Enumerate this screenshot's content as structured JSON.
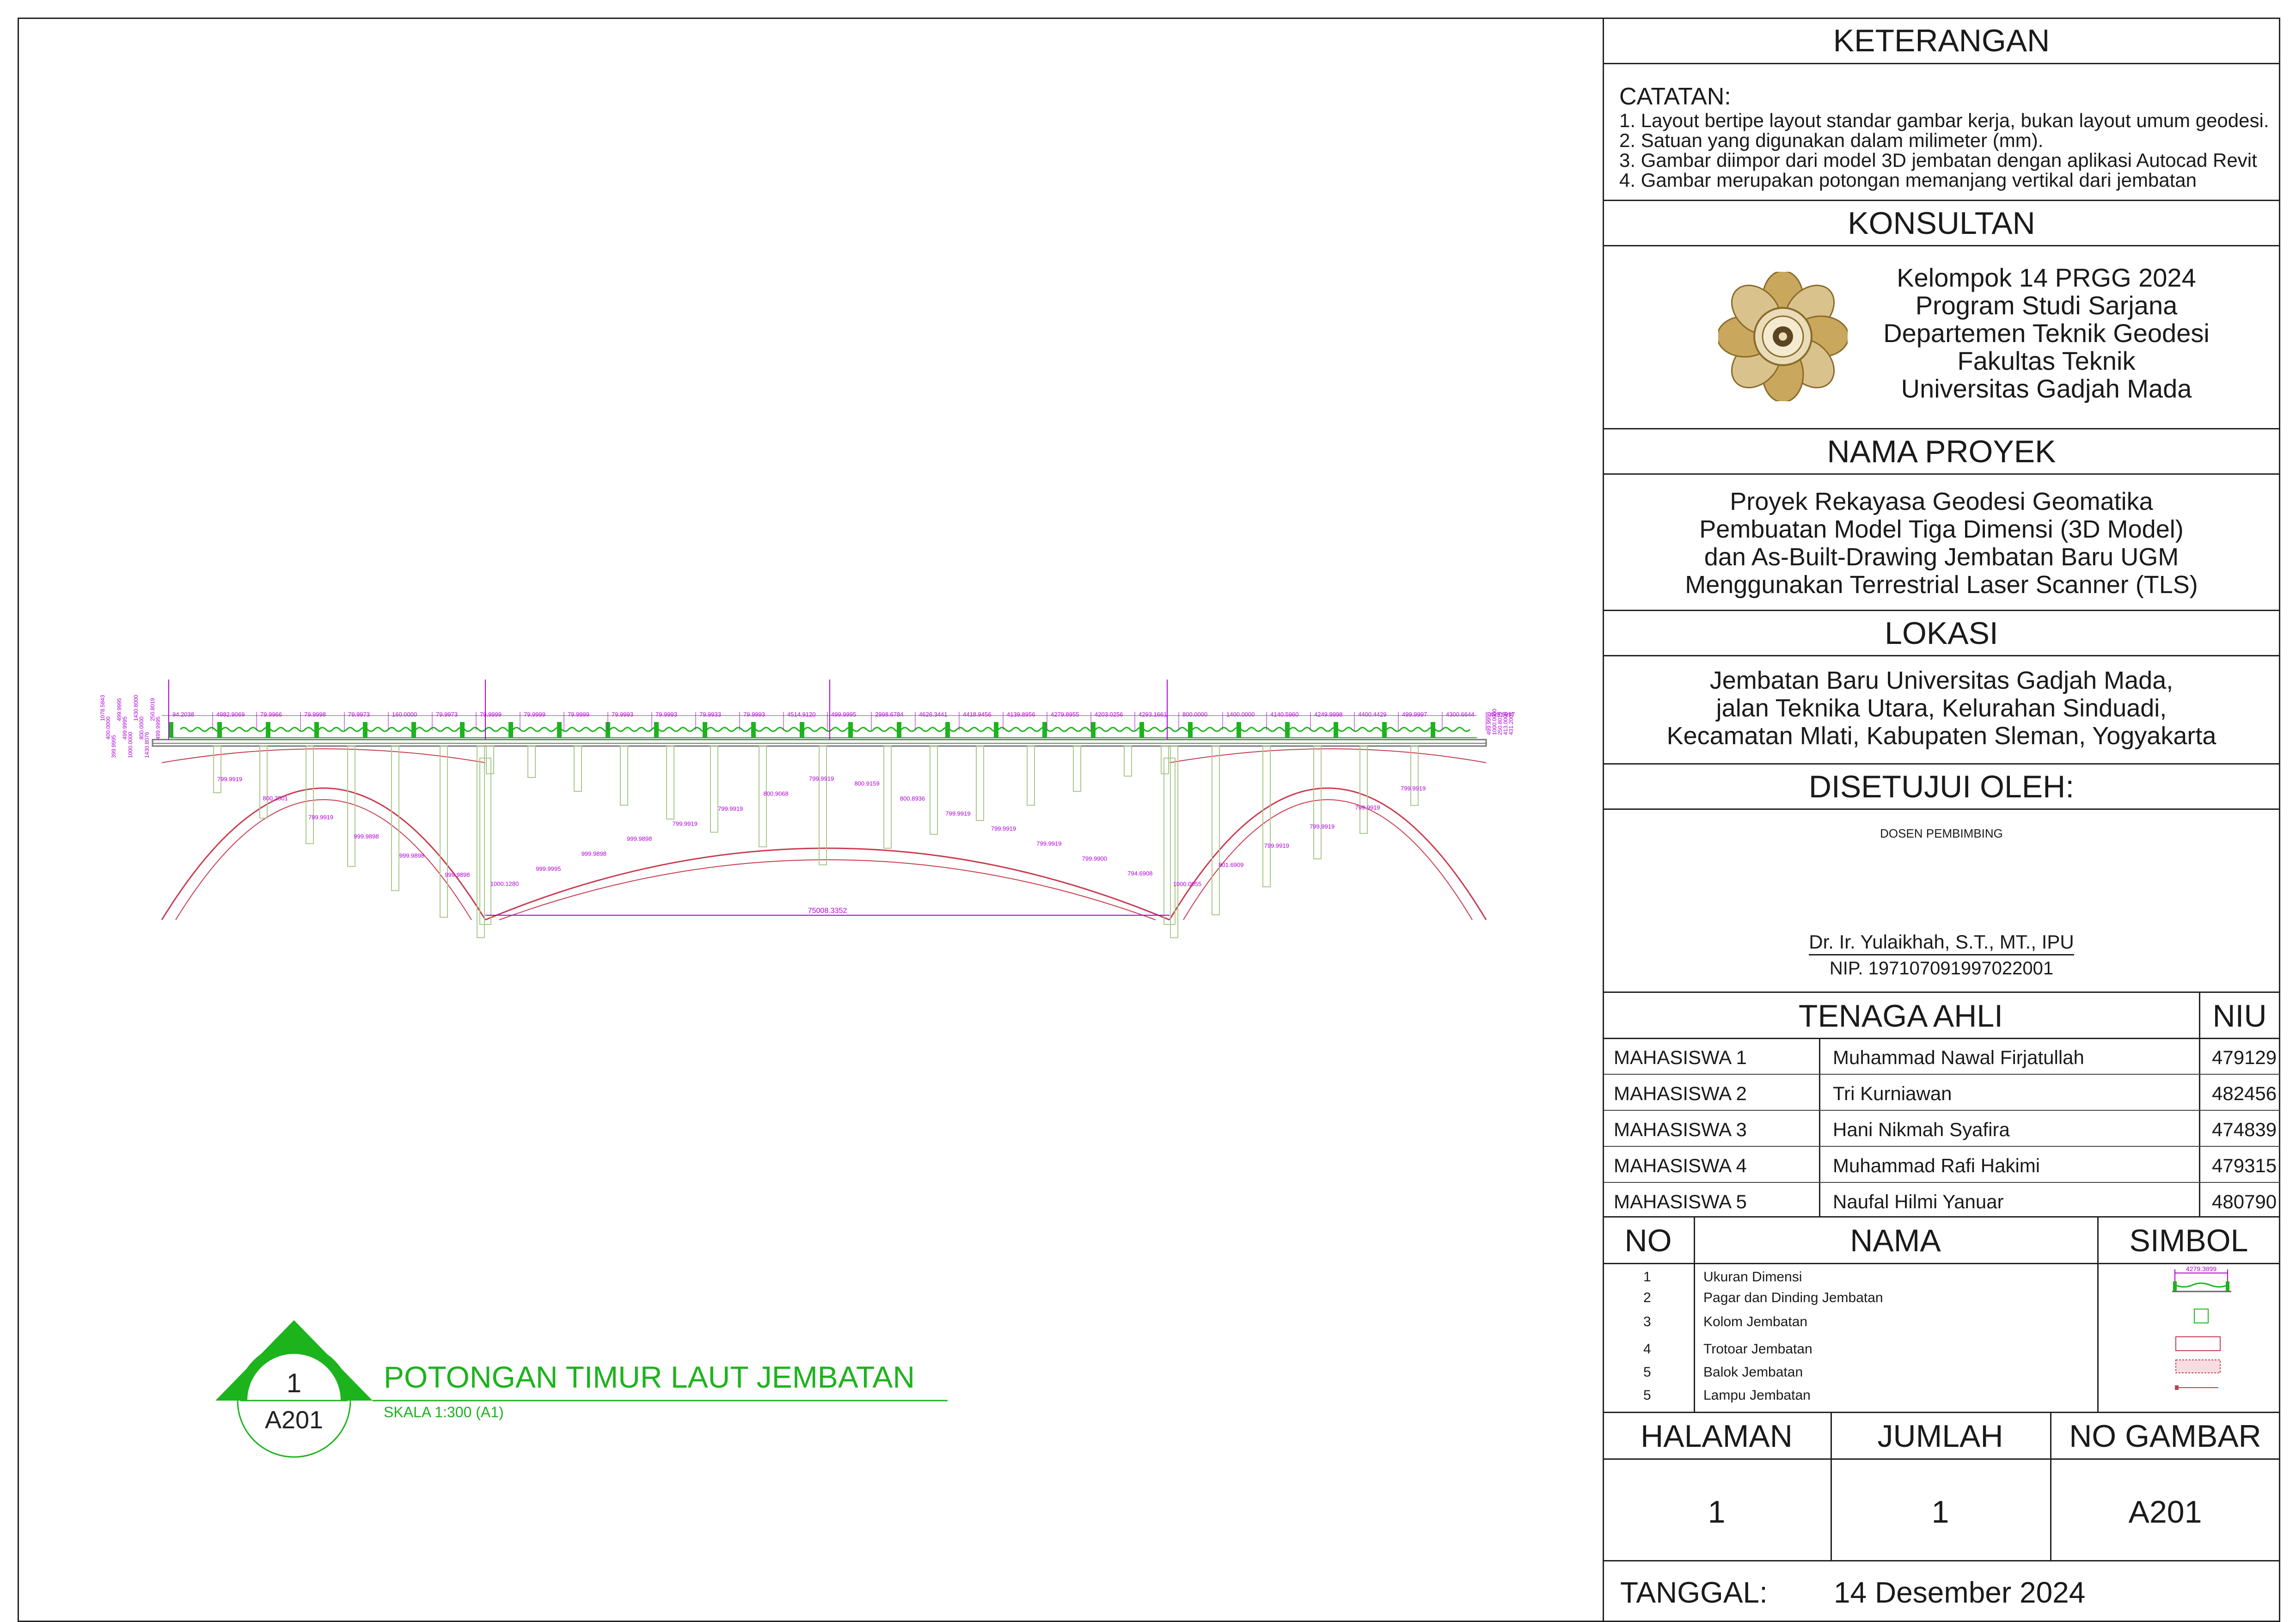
{
  "title_block": {
    "keterangan_header": "KETERANGAN",
    "catatan_label": "CATATAN:",
    "notes": [
      "1. Layout bertipe layout standar gambar kerja, bukan layout umum geodesi.",
      "2. Satuan yang digunakan dalam milimeter (mm).",
      "3. Gambar diimpor dari model 3D jembatan dengan aplikasi Autocad Revit",
      "4. Gambar merupakan potongan memanjang vertikal dari jembatan"
    ],
    "konsultan_header": "KONSULTAN",
    "konsultan_lines": [
      "Kelompok 14 PRGG 2024",
      "Program Studi Sarjana",
      "Departemen Teknik Geodesi",
      "Fakultas Teknik",
      "Universitas Gadjah Mada"
    ],
    "nama_proyek_header": "NAMA PROYEK",
    "proyek_lines": [
      "Proyek Rekayasa Geodesi Geomatika",
      "Pembuatan Model Tiga Dimensi (3D Model)",
      "dan As-Built-Drawing Jembatan Baru UGM",
      "Menggunakan Terrestrial Laser Scanner (TLS)"
    ],
    "lokasi_header": "LOKASI",
    "lokasi_lines": [
      "Jembatan Baru Universitas Gadjah Mada,",
      "jalan Teknika Utara, Kelurahan Sinduadi,",
      "Kecamatan Mlati, Kabupaten Sleman, Yogyakarta"
    ],
    "disetujui_header": "DISETUJUI OLEH:",
    "dosen_label": "DOSEN PEMBIMBING",
    "dosen_name": "Dr. Ir. Yulaikhah, S.T., MT., IPU",
    "dosen_nip": "NIP. 197107091997022001",
    "tenaga_header": "TENAGA AHLI",
    "niu_header": "NIU",
    "team": [
      {
        "role": "MAHASISWA 1",
        "name": "Muhammad Nawal Firjatullah",
        "niu": "479129"
      },
      {
        "role": "MAHASISWA 2",
        "name": "Tri Kurniawan",
        "niu": "482456"
      },
      {
        "role": "MAHASISWA 3",
        "name": "Hani Nikmah Syafira",
        "niu": "474839"
      },
      {
        "role": "MAHASISWA 4",
        "name": "Muhammad Rafi Hakimi",
        "niu": "479315"
      },
      {
        "role": "MAHASISWA 5",
        "name": "Naufal Hilmi Yanuar",
        "niu": "480790"
      }
    ],
    "legend_headers": {
      "no": "NO",
      "nama": "NAMA",
      "simbol": "SIMBOL"
    },
    "legend": [
      {
        "no": "1",
        "nama": "Ukuran Dimensi"
      },
      {
        "no": "2",
        "nama": "Pagar dan Dinding Jembatan"
      },
      {
        "no": "3",
        "nama": "Kolom Jembatan"
      },
      {
        "no": "4",
        "nama": "Trotoar Jembatan"
      },
      {
        "no": "5",
        "nama": "Balok Jembatan"
      },
      {
        "no": "5",
        "nama": "Lampu Jembatan"
      }
    ],
    "legend_dim_sample": "4279.3899",
    "halaman_header": "HALAMAN",
    "jumlah_header": "JUMLAH",
    "no_gambar_header": "NO GAMBAR",
    "halaman": "1",
    "jumlah": "1",
    "no_gambar": "A201",
    "tanggal_label": "TANGGAL:",
    "tanggal": "14 Desember 2024"
  },
  "drawing": {
    "view_number": "1",
    "sheet_ref": "A201",
    "view_title": "POTONGAN TIMUR LAUT JEMBATAN",
    "scale": "SKALA 1:300 (A1)",
    "overall_dimension": "75008.3352",
    "top_dimensions": [
      "94.2038",
      "4982.9069",
      "79.9966",
      "79.9998",
      "79.9973",
      "160.0000",
      "79.9973",
      "79.9999",
      "79.9999",
      "79.9999",
      "79.9993",
      "79.9993",
      "79.9933",
      "79.9993",
      "4514.9120",
      "499.9995",
      "2998.6784",
      "4626.3441",
      "4418.9456",
      "4139.8956",
      "4279.8955",
      "4203.0256",
      "4293.1661",
      "800.0000",
      "1400.0000",
      "4140.5960",
      "4249.9998",
      "4400.4429",
      "499.9997",
      "4300.6644",
      "499.9997"
    ],
    "lower_dimensions": [
      "799.9919",
      "800.2501",
      "799.9919",
      "999.9898",
      "999.9898",
      "999.9898",
      "1000.1280",
      "999.9995",
      "999.9898",
      "999.9898",
      "799.9919",
      "799.9919",
      "800.9068",
      "799.9919",
      "800.9159",
      "800.8936",
      "799.9919",
      "799.9919",
      "799.9919",
      "799.9900",
      "794.6908",
      "1000.0055",
      "801.6909",
      "799.9919",
      "799.9919",
      "799.9919",
      "799.9919"
    ],
    "left_dimensions": [
      "1078.5843",
      "400.0000",
      "399.9995",
      "499.9995",
      "499.9995",
      "1000.0000",
      "1430.8000",
      "800.0000",
      "1430.8076",
      "250.8019",
      "499.9995"
    ],
    "right_dimensions": [
      "499.9999",
      "1000.0000",
      "250.8019",
      "413.0000",
      "431.2001"
    ]
  },
  "colors": {
    "dimension": "#b000d8",
    "green": "#1db31d",
    "arch": "#c83c50",
    "column": "#a8c88a",
    "deck": "#777777",
    "frame": "#222222"
  }
}
